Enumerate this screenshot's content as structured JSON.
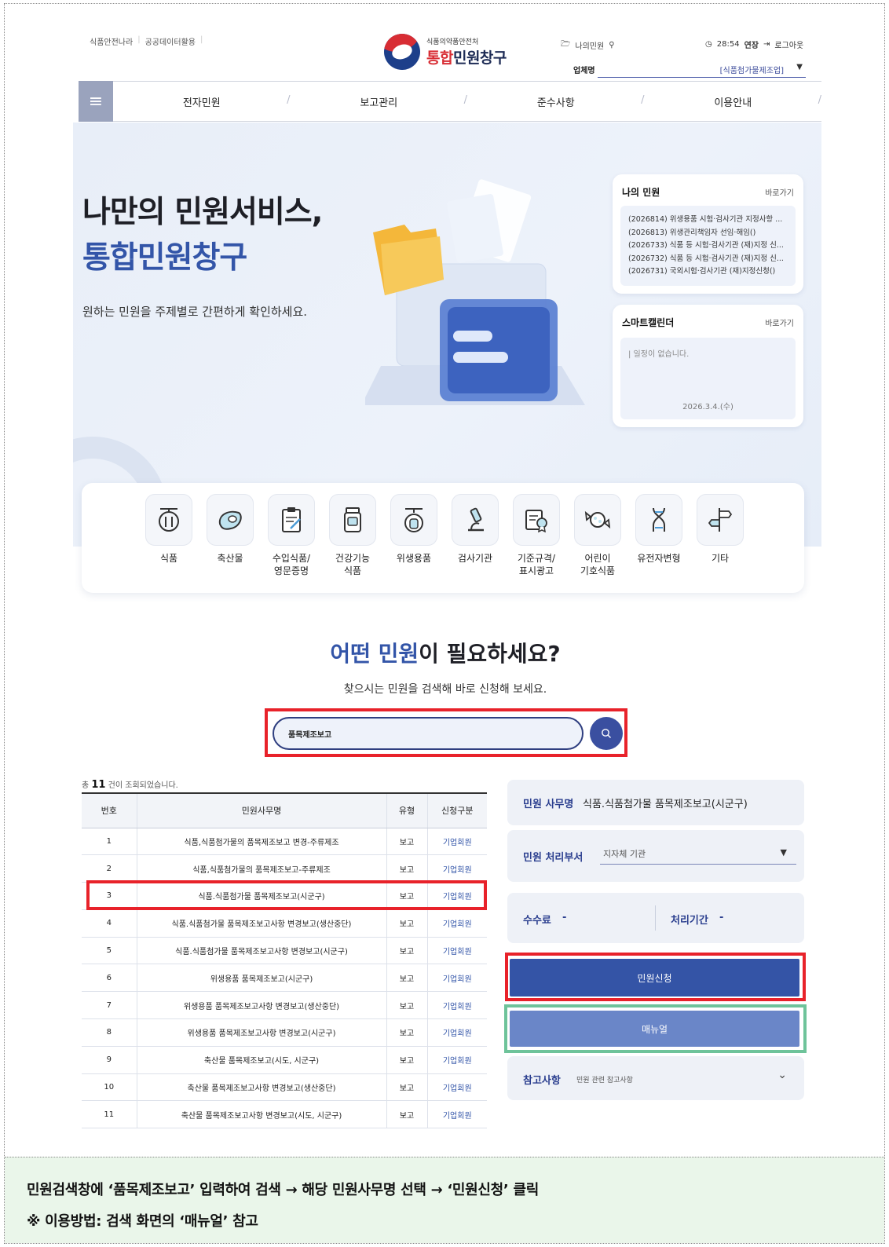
{
  "header": {
    "util_links": [
      "식품안전나라",
      "공공데이터활용"
    ],
    "logo_small": "식품의약품안전처",
    "logo_red": "통합",
    "logo_blue": "민원창구",
    "my_label": "나의민원",
    "timer": "28:54",
    "extend": "연장",
    "logout": "로그아웃",
    "company_label": "업체명",
    "company_value": "[식품첨가물제조업]"
  },
  "nav": [
    "전자민원",
    "보고관리",
    "준수사항",
    "이용안내"
  ],
  "hero": {
    "line1": "나만의 민원서비스,",
    "line2": "통합민원창구",
    "subtitle": "원하는 민원을 주제별로 간편하게 확인하세요."
  },
  "my_complaints": {
    "title": "나의 민원",
    "link": "바로가기",
    "items": [
      "(2026814) 위생용품 시험·검사기관 지정사항 ...",
      "(2026813) 위생관리책임자 선임·해임()",
      "(2026733) 식품 등 시험·검사기관 (재)지정 신...",
      "(2026732) 식품 등 시험·검사기관 (재)지정 신...",
      "(2026731) 국외시험·검사기관 (재)지정신청()"
    ]
  },
  "calendar": {
    "title": "스마트캘린더",
    "link": "바로가기",
    "empty": "| 일정이 없습니다.",
    "date": "2026.3.4.(수)"
  },
  "categories": [
    {
      "label": "식품",
      "icon": "food-icon"
    },
    {
      "label": "축산물",
      "icon": "meat-icon"
    },
    {
      "label": "수입식품/\n영문증명",
      "icon": "import-food-icon"
    },
    {
      "label": "건강기능\n식품",
      "icon": "health-food-icon"
    },
    {
      "label": "위생용품",
      "icon": "hygiene-icon"
    },
    {
      "label": "검사기관",
      "icon": "microscope-icon"
    },
    {
      "label": "기준규격/\n표시광고",
      "icon": "certificate-icon"
    },
    {
      "label": "어린이\n기호식품",
      "icon": "candy-icon"
    },
    {
      "label": "유전자변형",
      "icon": "dna-icon"
    },
    {
      "label": "기타",
      "icon": "signpost-icon"
    }
  ],
  "search": {
    "title_blue": "어떤 민원",
    "title_rest": "이 필요하세요?",
    "subtitle": "찾으시는 민원을 검색해 바로 신청해 보세요.",
    "value": "품목제조보고"
  },
  "results": {
    "count_prefix": "총",
    "count": "11",
    "count_suffix": "건이 조회되었습니다.",
    "headers": [
      "번호",
      "민원사무명",
      "유형",
      "신청구분"
    ],
    "rows": [
      [
        "1",
        "식품,식품첨가물의 품목제조보고 변경-주류제조",
        "보고",
        "기업회원"
      ],
      [
        "2",
        "식품,식품첨가물의 품목제조보고-주류제조",
        "보고",
        "기업회원"
      ],
      [
        "3",
        "식품.식품첨가물 품목제조보고(시군구)",
        "보고",
        "기업회원"
      ],
      [
        "4",
        "식품.식품첨가물 품목제조보고사항 변경보고(생산중단)",
        "보고",
        "기업회원"
      ],
      [
        "5",
        "식품.식품첨가물 품목제조보고사항 변경보고(시군구)",
        "보고",
        "기업회원"
      ],
      [
        "6",
        "위생용품 품목제조보고(시군구)",
        "보고",
        "기업회원"
      ],
      [
        "7",
        "위생용품 품목제조보고사항 변경보고(생산중단)",
        "보고",
        "기업회원"
      ],
      [
        "8",
        "위생용품 품목제조보고사항 변경보고(시군구)",
        "보고",
        "기업회원"
      ],
      [
        "9",
        "축산물 품목제조보고(시도, 시군구)",
        "보고",
        "기업회원"
      ],
      [
        "10",
        "축산물 품목제조보고사항 변경보고(생산중단)",
        "보고",
        "기업회원"
      ],
      [
        "11",
        "축산물 품목제조보고사항 변경보고(시도, 시군구)",
        "보고",
        "기업회원"
      ]
    ]
  },
  "detail": {
    "name_label": "민원 사무명",
    "name_value": "식품.식품첨가물 품목제조보고(시군구)",
    "dept_label": "민원 처리부서",
    "dept_value": "지자체 기관",
    "fee_label": "수수료",
    "fee_value": "-",
    "period_label": "처리기간",
    "period_value": "-",
    "apply_button": "민원신청",
    "manual_button": "매뉴얼",
    "ref_label": "참고사항",
    "ref_text": "민원 관련 참고사항"
  },
  "note": {
    "line1": "민원검색창에 ‘품목제조보고’ 입력하여 검색 → 해당 민원사무명 선택 → ‘민원신청’ 클릭",
    "line2": "※ 이용방법: 검색 화면의 ‘매뉴얼’ 참고"
  },
  "colors": {
    "brand_blue": "#3355a8",
    "brand_red": "#d82d34",
    "highlight_red": "#e8222a",
    "highlight_green": "#6ec39a"
  }
}
